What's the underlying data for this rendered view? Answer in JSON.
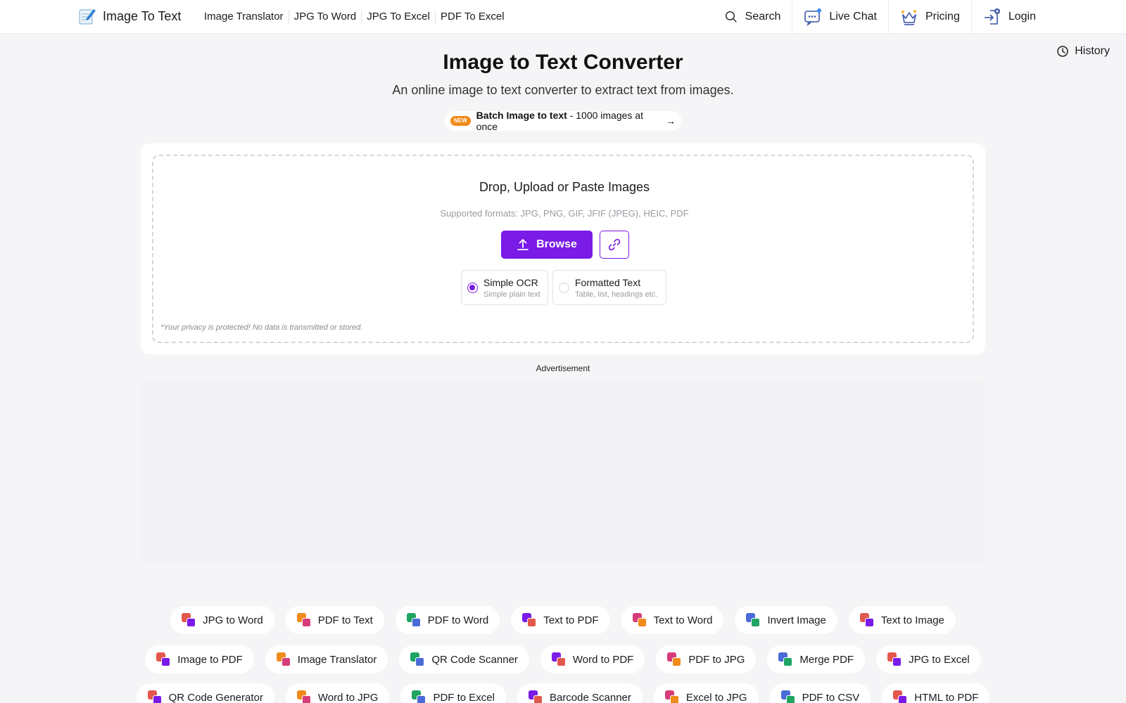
{
  "header": {
    "logo_text": "Image To Text",
    "nav": [
      "Image Translator",
      "JPG To Word",
      "JPG To Excel",
      "PDF To Excel"
    ],
    "search_label": "Search",
    "livechat_label": "Live Chat",
    "pricing_label": "Pricing",
    "login_label": "Login",
    "history_label": "History"
  },
  "hero": {
    "title": "Image to Text Converter",
    "subtitle": "An online image to text converter to extract text from images.",
    "new_badge": "NEW",
    "batch_bold": "Batch Image to text",
    "batch_rest": " - 1000 images at once",
    "batch_arrow": "→"
  },
  "upload": {
    "title": "Drop, Upload or Paste Images",
    "formats": "Supported formats: JPG, PNG, GIF, JFIF (JPEG), HEIC, PDF",
    "browse_label": "Browse",
    "options": [
      {
        "label": "Simple OCR",
        "desc": "Simple plain text",
        "selected": true
      },
      {
        "label": "Formatted Text",
        "desc": "Table, list, headings etc.",
        "selected": false
      }
    ],
    "privacy": "*Your privacy is protected! No data is transmitted or stored."
  },
  "ad": {
    "label": "Advertisement"
  },
  "tools": {
    "row1": [
      "JPG to Word",
      "PDF to Text",
      "PDF to Word",
      "Text to PDF",
      "Text to Word",
      "Invert Image",
      "Text to Image"
    ],
    "row2": [
      "Image to PDF",
      "Image Translator",
      "QR Code Scanner",
      "Word to PDF",
      "PDF to JPG",
      "Merge PDF",
      "JPG to Excel"
    ],
    "row3": [
      "QR Code Generator",
      "Word to JPG",
      "PDF to Excel",
      "Barcode Scanner",
      "Excel to JPG",
      "PDF to CSV",
      "HTML to PDF"
    ]
  },
  "colors": {
    "accent": "#7a1be8",
    "new_badge": "#f08a1b",
    "page_bg": "#f5f5f7"
  }
}
